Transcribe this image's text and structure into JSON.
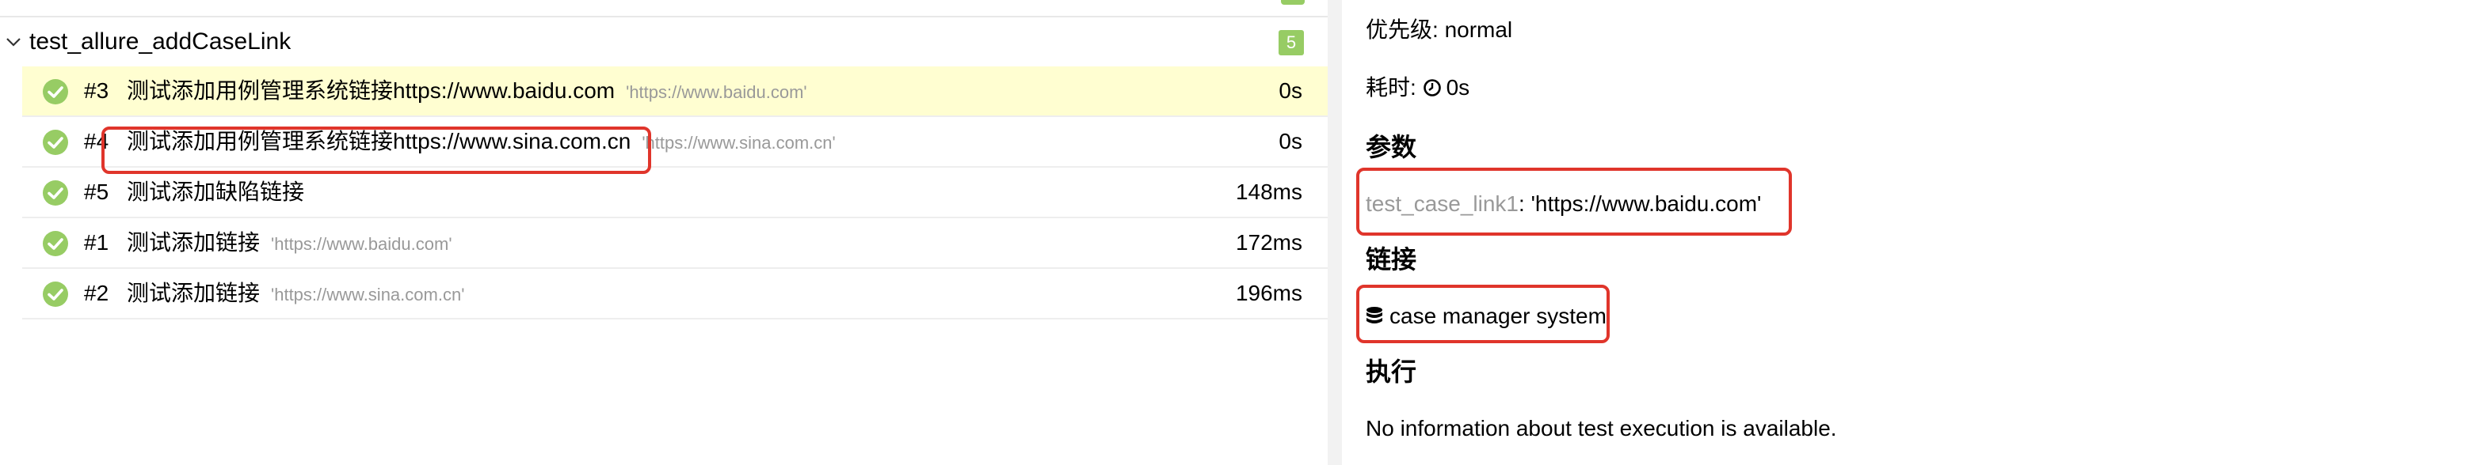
{
  "group": {
    "title": "test_allure_addCaseLink",
    "count": "5"
  },
  "tests": [
    {
      "num": "#3",
      "name": "测试添加用例管理系统链接https://www.baidu.com",
      "param": "'https://www.baidu.com'",
      "duration": "0s",
      "status": "passed",
      "active": true
    },
    {
      "num": "#4",
      "name": "测试添加用例管理系统链接https://www.sina.com.cn",
      "param": "'https://www.sina.com.cn'",
      "duration": "0s",
      "status": "passed",
      "active": false
    },
    {
      "num": "#5",
      "name": "测试添加缺陷链接",
      "param": "",
      "duration": "148ms",
      "status": "passed",
      "active": false
    },
    {
      "num": "#1",
      "name": "测试添加链接",
      "param": "'https://www.baidu.com'",
      "duration": "172ms",
      "status": "passed",
      "active": false
    },
    {
      "num": "#2",
      "name": "测试添加链接",
      "param": "'https://www.sina.com.cn'",
      "duration": "196ms",
      "status": "passed",
      "active": false
    }
  ],
  "details": {
    "severity_label": "优先级:",
    "severity_value": "normal",
    "duration_label": "耗时:",
    "duration_value": "0s",
    "params_heading": "参数",
    "param_name": "test_case_link1",
    "param_sep": ":",
    "param_value": "'https://www.baidu.com'",
    "links_heading": "链接",
    "link_text": "case manager system",
    "link_icon": "database-icon",
    "execution_heading": "执行",
    "execution_text": "No information about test execution is available."
  },
  "colors": {
    "passed": "#97cc64",
    "active_row": "#fffed1",
    "annotation": "#e0352b",
    "muted_text": "#999999"
  }
}
